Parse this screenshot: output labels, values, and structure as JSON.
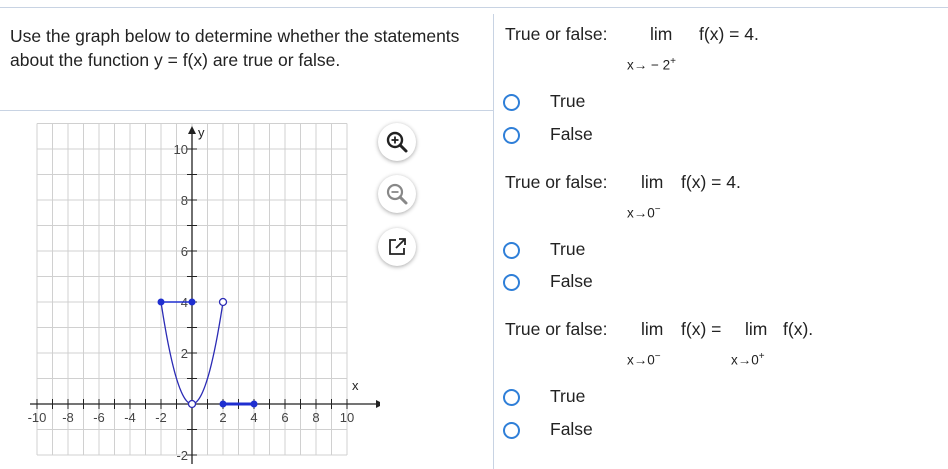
{
  "instructions": "Use the graph below to determine whether the statements about the function y = f(x) are true or false.",
  "graph": {
    "axis_x_label": "x",
    "axis_y_label": "y",
    "x_tick_labels": [
      "-10",
      "-8",
      "-6",
      "-4",
      "-2",
      "2",
      "4",
      "6",
      "8",
      "10"
    ],
    "y_tick_labels": [
      "10",
      "8",
      "6",
      "4",
      "2",
      "-2"
    ],
    "line_color": "#2b2bb5",
    "dot_color": "#1f2fd0",
    "grid_color": "#d0d0d0"
  },
  "tools": {
    "zoom_in_icon": "zoom-in-icon",
    "zoom_out_icon": "zoom-out-icon",
    "popout_icon": "external-link-icon"
  },
  "questions": [
    {
      "prefix": "True or false:",
      "lim": "lim",
      "expr": "f(x) = 4.",
      "sub": "x→ − 2",
      "sub_sup": "+",
      "options": [
        "True",
        "False"
      ]
    },
    {
      "prefix": "True or false:",
      "lim": "lim",
      "expr": "f(x) = 4.",
      "sub": "x→0",
      "sub_sup": "−",
      "options": [
        "True",
        "False"
      ]
    },
    {
      "prefix": "True or false:",
      "lim": "lim",
      "expr": "f(x) =",
      "sub": "x→0",
      "sub_sup": "−",
      "lim2": "lim",
      "expr2": "f(x).",
      "sub2": "x→0",
      "sub2_sup": "+",
      "options": [
        "True",
        "False"
      ]
    }
  ],
  "accent_color": "#2f7fd8"
}
